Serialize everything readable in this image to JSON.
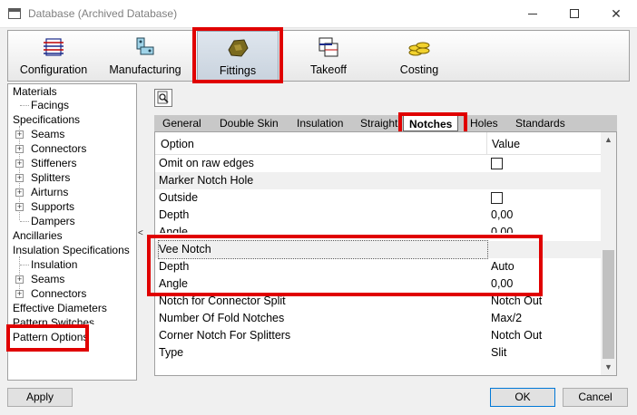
{
  "window": {
    "title": "Database (Archived Database)"
  },
  "toolbar": {
    "items": [
      {
        "label": "Configuration",
        "icon": "configuration-icon"
      },
      {
        "label": "Manufacturing",
        "icon": "manufacturing-icon"
      },
      {
        "label": "Fittings",
        "icon": "fittings-icon",
        "active": true
      },
      {
        "label": "Takeoff",
        "icon": "takeoff-icon"
      },
      {
        "label": "Costing",
        "icon": "costing-icon"
      }
    ]
  },
  "tree": {
    "items": [
      {
        "label": "Materials"
      },
      {
        "label": "Facings"
      },
      {
        "label": "Specifications"
      },
      {
        "label": "Seams"
      },
      {
        "label": "Connectors"
      },
      {
        "label": "Stiffeners"
      },
      {
        "label": "Splitters"
      },
      {
        "label": "Airturns"
      },
      {
        "label": "Supports"
      },
      {
        "label": "Dampers"
      },
      {
        "label": "Ancillaries"
      },
      {
        "label": "Insulation Specifications"
      },
      {
        "label": "Insulation"
      },
      {
        "label": "Seams"
      },
      {
        "label": "Connectors"
      },
      {
        "label": "Effective Diameters"
      },
      {
        "label": "Pattern Switches"
      },
      {
        "label": "Pattern Options"
      }
    ],
    "expander_symbol": "+"
  },
  "tabs": [
    {
      "label": "General"
    },
    {
      "label": "Double Skin"
    },
    {
      "label": "Insulation"
    },
    {
      "label": "Straight"
    },
    {
      "label": "Notches",
      "active": true
    },
    {
      "label": "Holes"
    },
    {
      "label": "Standards"
    }
  ],
  "grid": {
    "headers": {
      "option": "Option",
      "value": "Value"
    },
    "rows": [
      {
        "option": "Omit on raw edges",
        "value": "",
        "checkbox": true
      },
      {
        "option": "Marker Notch Hole",
        "value": "",
        "category": true
      },
      {
        "option": "Outside",
        "value": "",
        "checkbox": true
      },
      {
        "option": "Depth",
        "value": "0,00"
      },
      {
        "option": "Angle",
        "value": "0,00"
      },
      {
        "option": "Vee Notch",
        "value": "",
        "category": true,
        "selected": true
      },
      {
        "option": "Depth",
        "value": "Auto"
      },
      {
        "option": "Angle",
        "value": "0,00"
      },
      {
        "option": "Notch for Connector Split",
        "value": "Notch Out"
      },
      {
        "option": "Number Of Fold Notches",
        "value": "Max/2"
      },
      {
        "option": "Corner Notch For Splitters",
        "value": "Notch Out"
      },
      {
        "option": "Type",
        "value": "Slit"
      }
    ]
  },
  "buttons": {
    "apply": "Apply",
    "ok": "OK",
    "cancel": "Cancel"
  },
  "splitter_arrow": "<",
  "scroll": {
    "up": "▲",
    "down": "▼"
  },
  "colors": {
    "highlight": "#e00000",
    "tab_strip": "#c8c8c8",
    "category_row": "#f0f0f0"
  }
}
